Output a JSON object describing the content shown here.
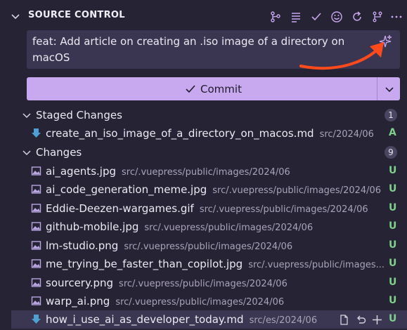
{
  "panel": {
    "title": "SOURCE CONTROL",
    "toolbar_icons": [
      "graph-icon",
      "list-icon",
      "check-icon",
      "smiley-icon",
      "refresh-icon",
      "branch-icon",
      "more-icon"
    ]
  },
  "commit_message": {
    "value": "feat: Add article on creating an .iso image of a directory on macOS",
    "generate_icon": "sparkle-icon"
  },
  "commit_button": {
    "label": "Commit",
    "icon": "check-icon",
    "dropdown_icon": "chevron-down-icon"
  },
  "colors": {
    "background": "#262335",
    "accent": "#c8a9f0",
    "status_added": "#7ed08a",
    "arrow": "#ff4a1c"
  },
  "staged": {
    "label": "Staged Changes",
    "count": "1",
    "files": [
      {
        "name": "create_an_iso_image_of_a_directory_on_macos.md",
        "path": "src/2024/06",
        "status": "A",
        "icon": "markdown-arrow-icon"
      }
    ]
  },
  "changes": {
    "label": "Changes",
    "count": "9",
    "files": [
      {
        "name": "ai_agents.jpg",
        "path": "src/.vuepress/public/images/2024/06",
        "status": "U",
        "icon": "image-icon"
      },
      {
        "name": "ai_code_generation_meme.jpg",
        "path": "src/.vuepress/public/images/2024/06",
        "status": "U",
        "icon": "image-icon"
      },
      {
        "name": "Eddie-Deezen-wargames.gif",
        "path": "src/.vuepress/public/images/2024/06",
        "status": "U",
        "icon": "image-icon"
      },
      {
        "name": "github-mobile.jpg",
        "path": "src/.vuepress/public/images/2024/06",
        "status": "U",
        "icon": "image-icon"
      },
      {
        "name": "lm-studio.png",
        "path": "src/.vuepress/public/images/2024/06",
        "status": "U",
        "icon": "image-icon"
      },
      {
        "name": "me_trying_be_faster_than_copilot.jpg",
        "path": "src/.vuepress/public/images...",
        "status": "U",
        "icon": "image-icon"
      },
      {
        "name": "sourcery.png",
        "path": "src/.vuepress/public/images/2024/06",
        "status": "U",
        "icon": "image-icon"
      },
      {
        "name": "warp_ai.png",
        "path": "src/.vuepress/public/images/2024/06",
        "status": "U",
        "icon": "image-icon"
      },
      {
        "name": "how_i_use_ai_as_developer_today.md",
        "path": "src/es/2024/06",
        "status": "U",
        "icon": "markdown-arrow-icon",
        "row_actions": [
          "open-file-icon",
          "discard-icon",
          "stage-plus-icon"
        ]
      }
    ]
  }
}
